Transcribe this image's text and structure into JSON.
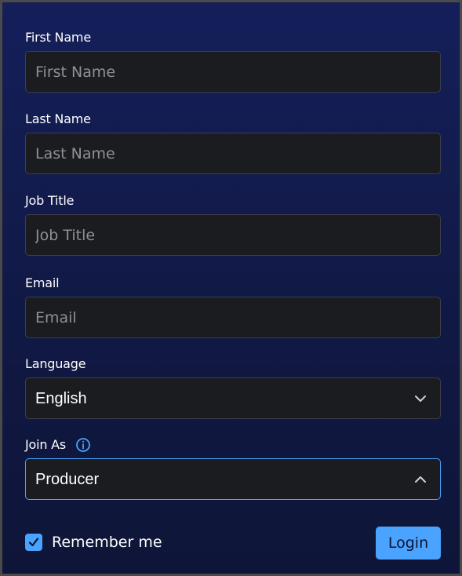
{
  "form": {
    "first_name": {
      "label": "First Name",
      "placeholder": "First Name",
      "value": ""
    },
    "last_name": {
      "label": "Last Name",
      "placeholder": "Last Name",
      "value": ""
    },
    "job_title": {
      "label": "Job Title",
      "placeholder": "Job Title",
      "value": ""
    },
    "email": {
      "label": "Email",
      "placeholder": "Email",
      "value": ""
    },
    "language": {
      "label": "Language",
      "selected": "English",
      "expanded": false,
      "icon": "chevron-down-icon"
    },
    "join_as": {
      "label": "Join As",
      "selected": "Producer",
      "expanded": true,
      "icon": "chevron-up-icon",
      "info_icon": "info-icon"
    }
  },
  "footer": {
    "remember_me": {
      "label": "Remember me",
      "checked": true
    },
    "login_label": "Login"
  },
  "colors": {
    "accent": "#4aa3ff",
    "background_top": "#141f5a",
    "background_bottom": "#0e1538",
    "input_background": "#1b1c1f",
    "input_border": "#3c3f47"
  }
}
